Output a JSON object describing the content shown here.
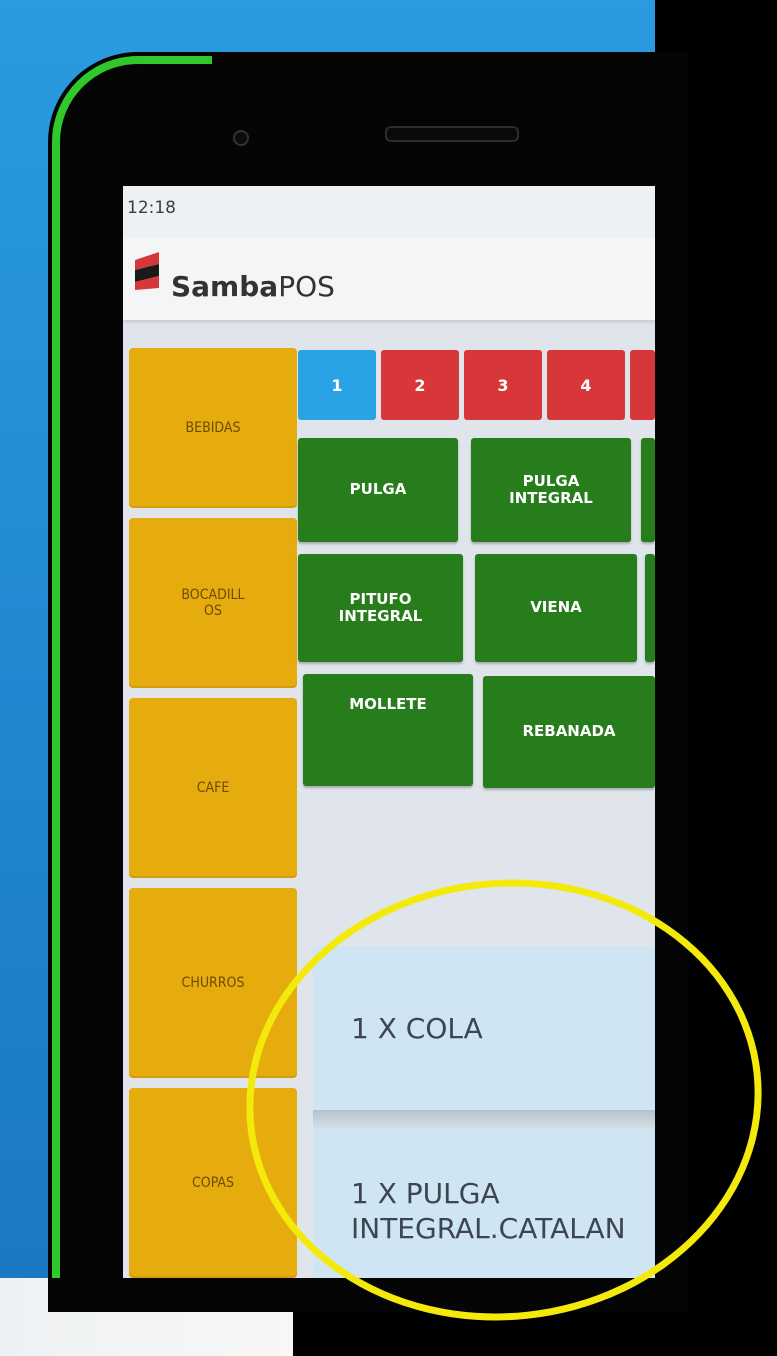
{
  "status": {
    "time": "12:18"
  },
  "brand": {
    "bold": "Samba",
    "light": "POS"
  },
  "categories": [
    {
      "label": "BEBIDAS"
    },
    {
      "label": "BOCADILL\nOS"
    },
    {
      "label": "CAFE"
    },
    {
      "label": "CHURROS"
    },
    {
      "label": "COPAS"
    }
  ],
  "pages": [
    "1",
    "2",
    "3",
    "4"
  ],
  "products": [
    {
      "label": "PULGA"
    },
    {
      "label": "PULGA\nINTEGRAL"
    },
    {
      "label": "PITUFO\nINTEGRAL"
    },
    {
      "label": "VIENA"
    },
    {
      "label": "MOLLETE"
    },
    {
      "label": "REBANADA"
    }
  ],
  "orders": [
    {
      "text": "1 X COLA"
    },
    {
      "text": "1 X PULGA\nINTEGRAL.CATALAN"
    }
  ],
  "colors": {
    "category": "#e6ab0c",
    "product": "#277c1c",
    "page_active": "#29a3e6",
    "page_inactive": "#d8373a",
    "highlight": "#f3ea0c",
    "device_rim": "#2fc92b"
  },
  "icons": {
    "logo": "sambapos-logo-icon"
  }
}
